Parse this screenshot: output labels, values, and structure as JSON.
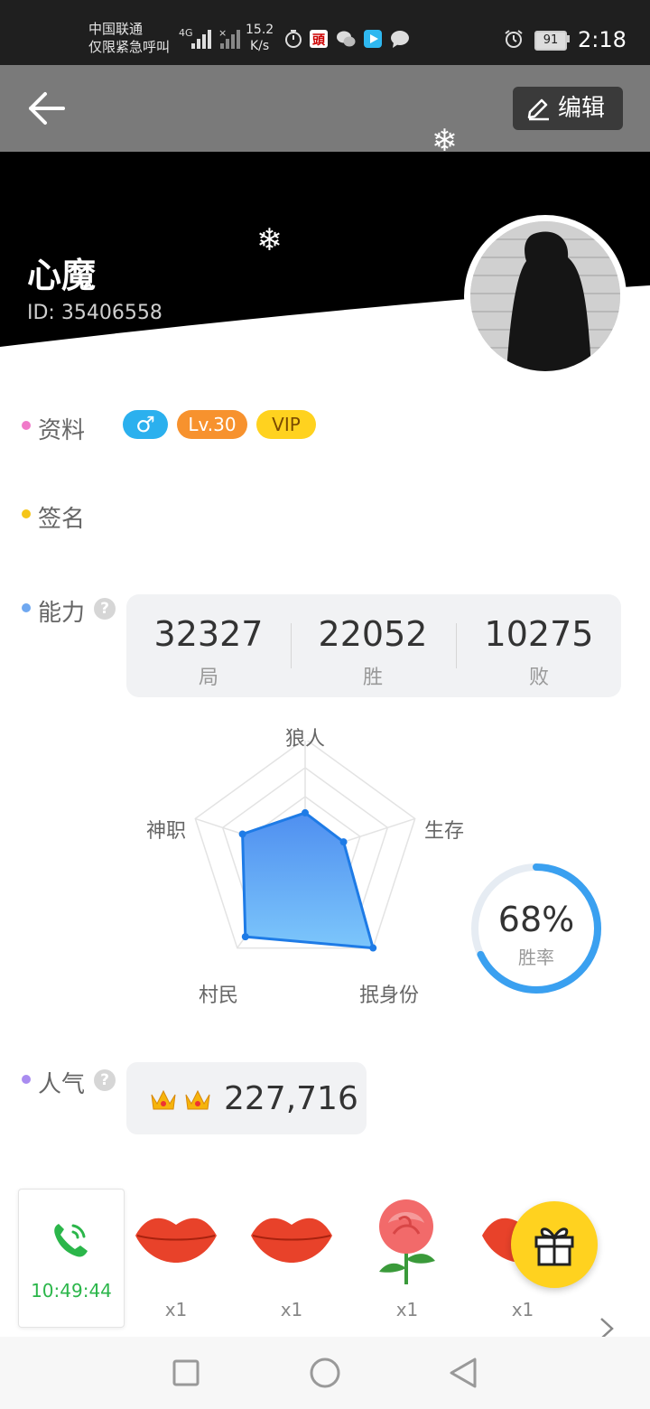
{
  "status_bar": {
    "carrier_line1": "中国联通",
    "carrier_line2": "仅限紧急呼叫",
    "network_type": "4G",
    "speed_value": "15.2",
    "speed_unit": "K/s",
    "battery": "91",
    "time": "2:18"
  },
  "top_bar": {
    "back_icon": "arrow-left-icon",
    "edit_label": "编辑",
    "edit_icon": "pencil-icon"
  },
  "profile": {
    "username": "心魔",
    "user_id": "ID: 35406558",
    "header_color": "#000000"
  },
  "info_section": {
    "label": "资料",
    "dot_color": "#f07ac9",
    "gender_icon": "male-icon",
    "level": "Lv.30",
    "vip": "VIP"
  },
  "signature_section": {
    "label": "签名",
    "dot_color": "#f5c518"
  },
  "ability_section": {
    "label": "能力",
    "dot_color": "#6fa8f0",
    "help": "?",
    "stats": [
      {
        "value": "32327",
        "label": "局"
      },
      {
        "value": "22052",
        "label": "胜"
      },
      {
        "value": "10275",
        "label": "败"
      }
    ],
    "radar": {
      "axes": [
        "狼人",
        "生存",
        "抿身份",
        "村民",
        "神职"
      ],
      "values": [
        0.36,
        0.35,
        1.0,
        0.88,
        0.57
      ]
    },
    "win_rate": {
      "value": "68%",
      "fraction": 0.68,
      "label": "胜率"
    }
  },
  "popularity_section": {
    "label": "人气",
    "dot_color": "#a98cf0",
    "help": "?",
    "value": "227,716"
  },
  "gifts": {
    "call_time": "10:49:44",
    "items": [
      {
        "icon": "lips-icon",
        "count": "x1"
      },
      {
        "icon": "lips-icon",
        "count": "x1"
      },
      {
        "icon": "rose-icon",
        "count": "x1"
      },
      {
        "icon": "lips-icon",
        "count": "x1"
      }
    ],
    "fab_icon": "gift-box-icon"
  },
  "nav_bar": {
    "recent": "square-icon",
    "home": "circle-icon",
    "back": "triangle-back-icon"
  }
}
